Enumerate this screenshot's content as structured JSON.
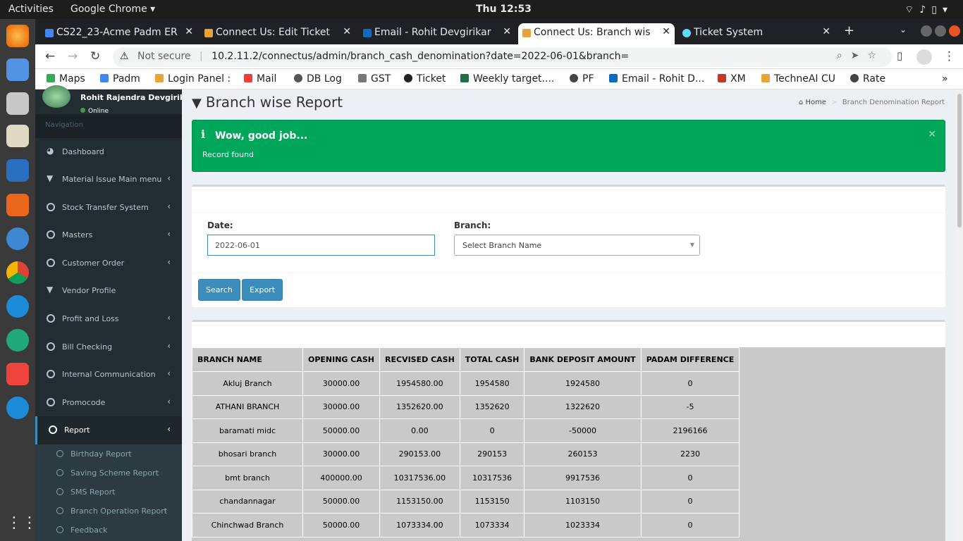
{
  "system": {
    "activities": "Activities",
    "app": "Google Chrome",
    "clock": "Thu 12:53"
  },
  "tabs": [
    {
      "label": "CS22_23-Acme Padm ER",
      "color": "#4285f4"
    },
    {
      "label": "Connect Us: Edit Ticket",
      "color": "#e8a33a"
    },
    {
      "label": "Email - Rohit Devgirikar",
      "color": "#0f6cbd"
    },
    {
      "label": "Connect Us: Branch wis",
      "color": "#e8a33a"
    },
    {
      "label": "Ticket System",
      "color": "#61dafb"
    }
  ],
  "url": {
    "not_secure": "Not secure",
    "address": "10.2.11.2/connectus/admin/branch_cash_denomination?date=2022-06-01&branch="
  },
  "bookmarks": [
    {
      "label": "Maps",
      "color": "#34a853"
    },
    {
      "label": "Padm",
      "color": "#4285f4"
    },
    {
      "label": "Login Panel :",
      "color": "#e8a33a"
    },
    {
      "label": "Mail",
      "color": "#ea4335"
    },
    {
      "label": "DB Log",
      "color": "#555555"
    },
    {
      "label": "GST",
      "color": "#777777"
    },
    {
      "label": "Ticket",
      "color": "#222222"
    },
    {
      "label": "Weekly target....",
      "color": "#1e7145"
    },
    {
      "label": "PF",
      "color": "#444444"
    },
    {
      "label": "Email - Rohit D...",
      "color": "#0f6cbd"
    },
    {
      "label": "XM",
      "color": "#c0392b"
    },
    {
      "label": "TechneAI CU",
      "color": "#e8a33a"
    },
    {
      "label": "Rate",
      "color": "#444444"
    }
  ],
  "user": {
    "name": "Rohit Rajendra Devgirikar",
    "status": "Online"
  },
  "nav": {
    "heading": "Navigation",
    "items": [
      {
        "label": "Dashboard"
      },
      {
        "label": "Material Issue Main menu"
      },
      {
        "label": "Stock Transfer System"
      },
      {
        "label": "Masters"
      },
      {
        "label": "Customer Order"
      },
      {
        "label": "Vendor Profile"
      },
      {
        "label": "Profit and Loss"
      },
      {
        "label": "Bill Checking"
      },
      {
        "label": "Internal Communication"
      },
      {
        "label": "Promocode"
      },
      {
        "label": "Report"
      }
    ],
    "subitems": [
      {
        "label": "Birthday Report"
      },
      {
        "label": "Saving Scheme Report"
      },
      {
        "label": "SMS Report"
      },
      {
        "label": "Branch Operation Report"
      },
      {
        "label": "Feedback"
      }
    ]
  },
  "page": {
    "title": "Branch wise Report",
    "crumb_home": "Home",
    "crumb_current": "Branch Denomination Report"
  },
  "alert": {
    "title": "Wow, good job...",
    "body": "Record found"
  },
  "form": {
    "date_label": "Date:",
    "date_value": "2022-06-01",
    "branch_label": "Branch:",
    "branch_value": "Select Branch Name",
    "search": "Search",
    "export": "Export"
  },
  "table": {
    "headers": [
      "BRANCH NAME",
      "OPENING CASH",
      "RECVISED CASH",
      "TOTAL CASH",
      "BANK DEPOSIT AMOUNT",
      "PADAM DIFFERENCE"
    ],
    "rows": [
      [
        "Akluj Branch",
        "30000.00",
        "1954580.00",
        "1954580",
        "1924580",
        "0"
      ],
      [
        "ATHANI BRANCH",
        "30000.00",
        "1352620.00",
        "1352620",
        "1322620",
        "-5"
      ],
      [
        "baramati midc",
        "50000.00",
        "0.00",
        "0",
        "-50000",
        "2196166"
      ],
      [
        "bhosari branch",
        "30000.00",
        "290153.00",
        "290153",
        "260153",
        "2230"
      ],
      [
        "bmt branch",
        "400000.00",
        "10317536.00",
        "10317536",
        "9917536",
        "0"
      ],
      [
        "chandannagar",
        "50000.00",
        "1153150.00",
        "1153150",
        "1103150",
        "0"
      ],
      [
        "Chinchwad Branch",
        "50000.00",
        "1073334.00",
        "1073334",
        "1023334",
        "0"
      ]
    ]
  }
}
